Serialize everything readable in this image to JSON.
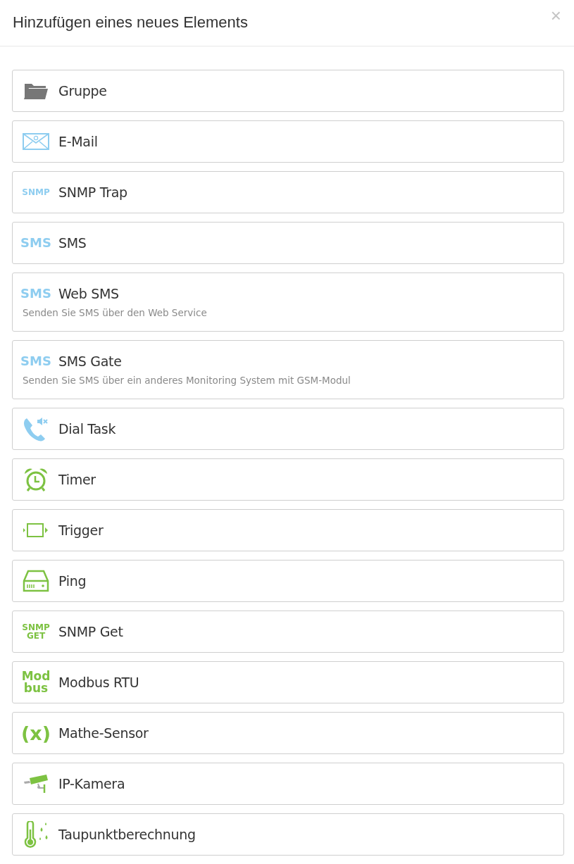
{
  "dialog": {
    "title": "Hinzufügen eines neues Elements",
    "close": "×"
  },
  "items": [
    {
      "label": "Gruppe",
      "kind": "folder",
      "color": "#777777"
    },
    {
      "label": "E-Mail",
      "kind": "mail",
      "color": "#8ecdf0"
    },
    {
      "label": "SNMP Trap",
      "kind": "text",
      "icon_lines": [
        "SNMP"
      ],
      "color": "#8ecdf0"
    },
    {
      "label": "SMS",
      "kind": "text",
      "icon_lines": [
        "SMS"
      ],
      "color": "#8ecdf0"
    },
    {
      "label": "Web SMS",
      "kind": "text",
      "icon_lines": [
        "SMS"
      ],
      "color": "#8ecdf0",
      "description": "Senden Sie SMS über den Web Service"
    },
    {
      "label": "SMS Gate",
      "kind": "text",
      "icon_lines": [
        "SMS"
      ],
      "color": "#8ecdf0",
      "description": "Senden Sie SMS über ein anderes Monitoring System mit GSM-Modul"
    },
    {
      "label": "Dial Task",
      "kind": "phone",
      "color": "#8ecdf0"
    },
    {
      "label": "Timer",
      "kind": "alarm",
      "color": "#7dc242"
    },
    {
      "label": "Trigger",
      "kind": "trigger",
      "color": "#7dc242"
    },
    {
      "label": "Ping",
      "kind": "server",
      "color": "#7dc242"
    },
    {
      "label": "SNMP Get",
      "kind": "text",
      "icon_lines": [
        "SNMP",
        "GET"
      ],
      "color": "#7dc242"
    },
    {
      "label": "Modbus RTU",
      "kind": "text",
      "icon_lines": [
        "Mod",
        "bus"
      ],
      "color": "#7dc242"
    },
    {
      "label": "Mathe-Sensor",
      "kind": "text",
      "icon_lines": [
        "(x)"
      ],
      "color": "#7dc242"
    },
    {
      "label": "IP-Kamera",
      "kind": "camera",
      "color": "#7dc242"
    },
    {
      "label": "Taupunktberechnung",
      "kind": "thermo",
      "color": "#7dc242"
    }
  ]
}
